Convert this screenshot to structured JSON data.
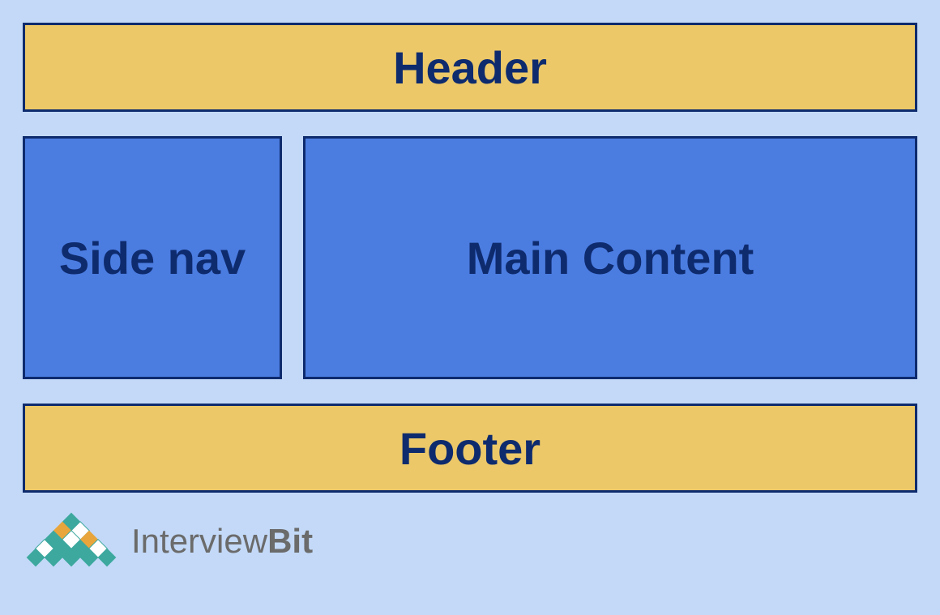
{
  "layout": {
    "header": "Header",
    "side_nav": "Side nav",
    "main_content": "Main Content",
    "footer": "Footer"
  },
  "logo": {
    "prefix": "Interview",
    "suffix": "Bit"
  },
  "colors": {
    "background": "#c3d9f7",
    "yellow_box": "#ecc868",
    "blue_box": "#4b7ce0",
    "border_text": "#0e2b6e",
    "logo_text": "#6b6b6b",
    "logo_teal": "#3ca89e",
    "logo_orange": "#e8a53c",
    "logo_white": "#ffffff"
  }
}
